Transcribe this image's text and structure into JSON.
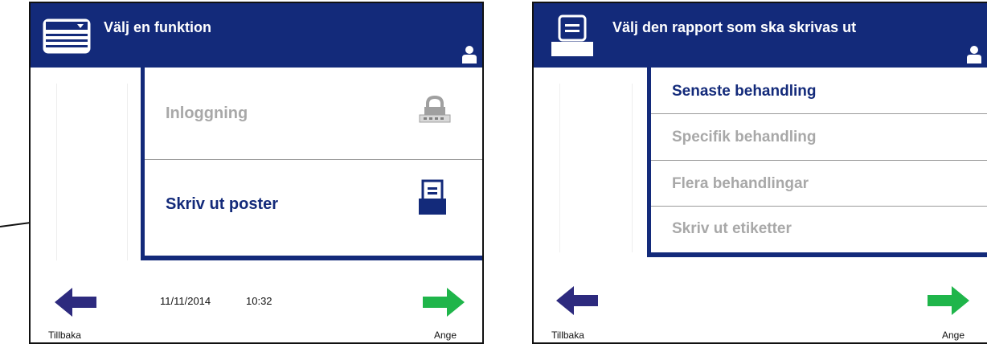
{
  "screen1": {
    "title": "Välj en funktion",
    "items": [
      {
        "label": "Inloggning",
        "state": "disabled",
        "icon": "padlock-icon"
      },
      {
        "label": "Skriv ut poster",
        "state": "active",
        "icon": "printer-icon"
      }
    ],
    "date": "11/11/2014",
    "time": "10:32",
    "back_label": "Tillbaka",
    "enter_label": "Ange"
  },
  "screen2": {
    "title": "Välj den rapport som ska skrivas ut",
    "items": [
      {
        "label": "Senaste behandling",
        "state": "active"
      },
      {
        "label": "Specifik behandling",
        "state": "disabled"
      },
      {
        "label": "Flera behandlingar",
        "state": "disabled"
      },
      {
        "label": "Skriv ut etiketter",
        "state": "disabled"
      }
    ],
    "back_label": "Tillbaka",
    "enter_label": "Ange"
  },
  "colors": {
    "header": "#132a7a",
    "back_arrow": "#2d2a7e",
    "enter_arrow": "#1fb54a",
    "disabled_text": "#a8a8a8"
  },
  "icons": [
    "menu-card-icon",
    "printer-icon",
    "user-icon",
    "padlock-icon",
    "back-arrow-icon",
    "enter-arrow-icon",
    "callout-arrow-icon"
  ]
}
